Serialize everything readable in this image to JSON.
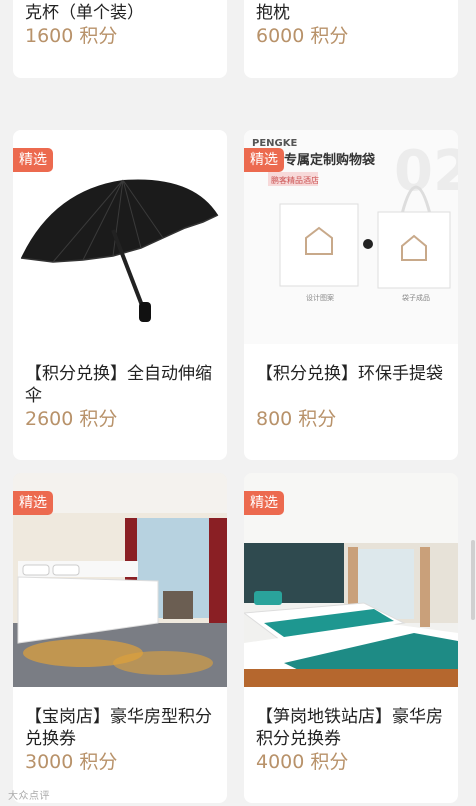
{
  "products": [
    {
      "title": "克杯（单个装）",
      "points": "1600",
      "unit": "积分"
    },
    {
      "title": "抱枕",
      "points": "6000",
      "unit": "积分"
    },
    {
      "badge": "精选",
      "title": "【积分兑换】全自动伸缩伞",
      "points": "2600",
      "unit": "积分"
    },
    {
      "badge": "精选",
      "title": "【积分兑换】环保手提袋",
      "points": "800",
      "unit": "积分",
      "image_text": {
        "brand": "PENGKE",
        "headline": "专属定制购物袋",
        "logo": "鹏客精品酒店",
        "caption_left": "设计图案",
        "caption_right": "袋子成品",
        "big_number": "02"
      }
    },
    {
      "badge": "精选",
      "title": "【宝岗店】豪华房型积分兑换券",
      "points": "3000",
      "unit": "积分"
    },
    {
      "badge": "精选",
      "title": "【笋岗地铁站店】豪华房积分兑换券",
      "points": "4000",
      "unit": "积分"
    }
  ],
  "watermark": "大众点评"
}
